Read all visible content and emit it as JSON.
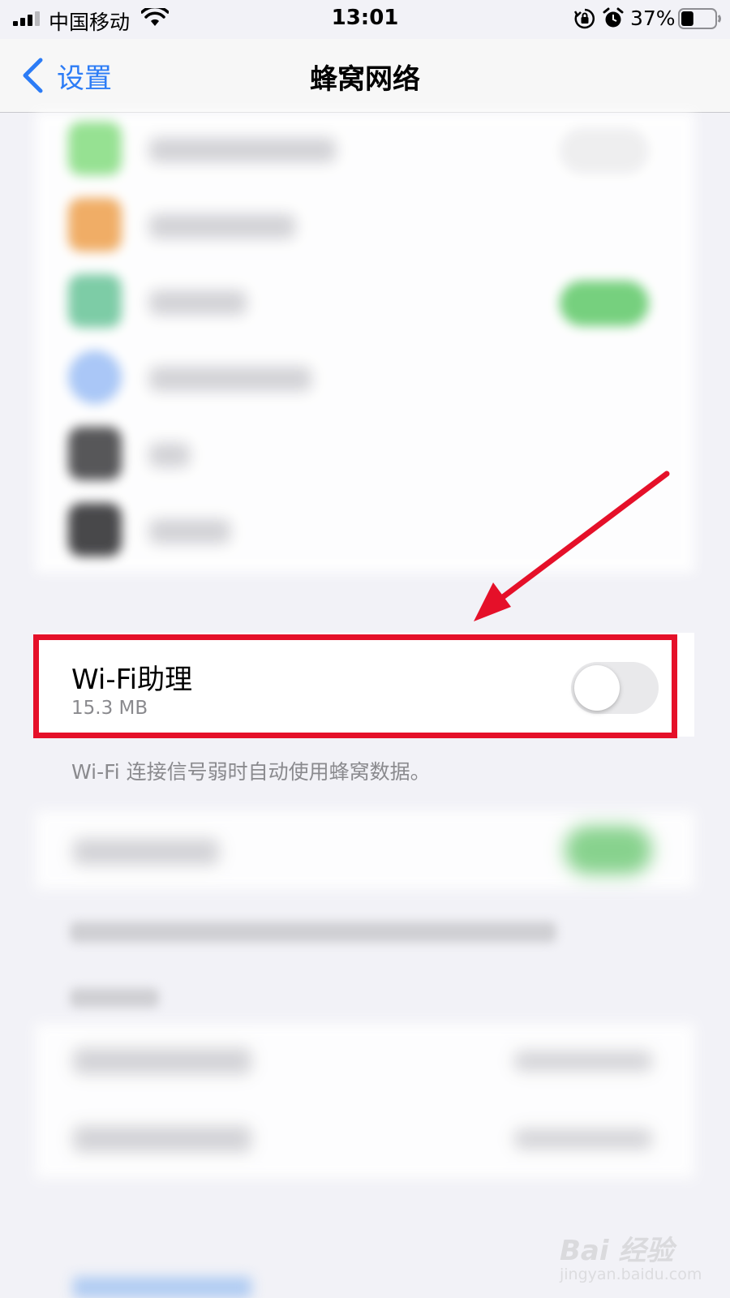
{
  "status_bar": {
    "carrier": "中国移动",
    "time": "13:01",
    "battery_percent": "37%",
    "battery_level": 0.37,
    "icons": [
      "signal-icon",
      "wifi-icon",
      "orientation-lock-icon",
      "alarm-icon",
      "battery-icon"
    ]
  },
  "nav": {
    "back_label": "设置",
    "title": "蜂窝网络"
  },
  "wifi_assist": {
    "title": "Wi-Fi助理",
    "usage": "15.3 MB",
    "enabled": false,
    "footer": "Wi-Fi 连接信号弱时自动使用蜂窝数据。"
  },
  "watermark": {
    "main": "Bai 经验",
    "sub": "jingyan.baidu.com"
  },
  "colors": {
    "accent": "#2c7cf6",
    "highlight": "#e51029",
    "toggle_off": "#e9e9eb",
    "background": "#f2f2f7"
  }
}
